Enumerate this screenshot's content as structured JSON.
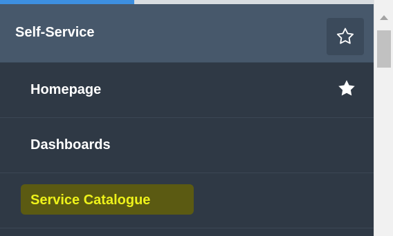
{
  "progress": {
    "fraction": 0.36
  },
  "sidebar": {
    "title": "Self-Service",
    "favorite_icon": "star-outline-icon",
    "items": [
      {
        "label": "Homepage",
        "icon": "star-filled-icon",
        "favorited": true
      },
      {
        "label": "Dashboards"
      },
      {
        "label": "Service Catalogue",
        "highlighted": true,
        "highlight_color": "#5b5a12",
        "text_color": "#eef21a"
      }
    ]
  },
  "colors": {
    "header_bg": "#47586b",
    "panel_bg": "#2f3945",
    "accent": "#3d8fe0"
  }
}
